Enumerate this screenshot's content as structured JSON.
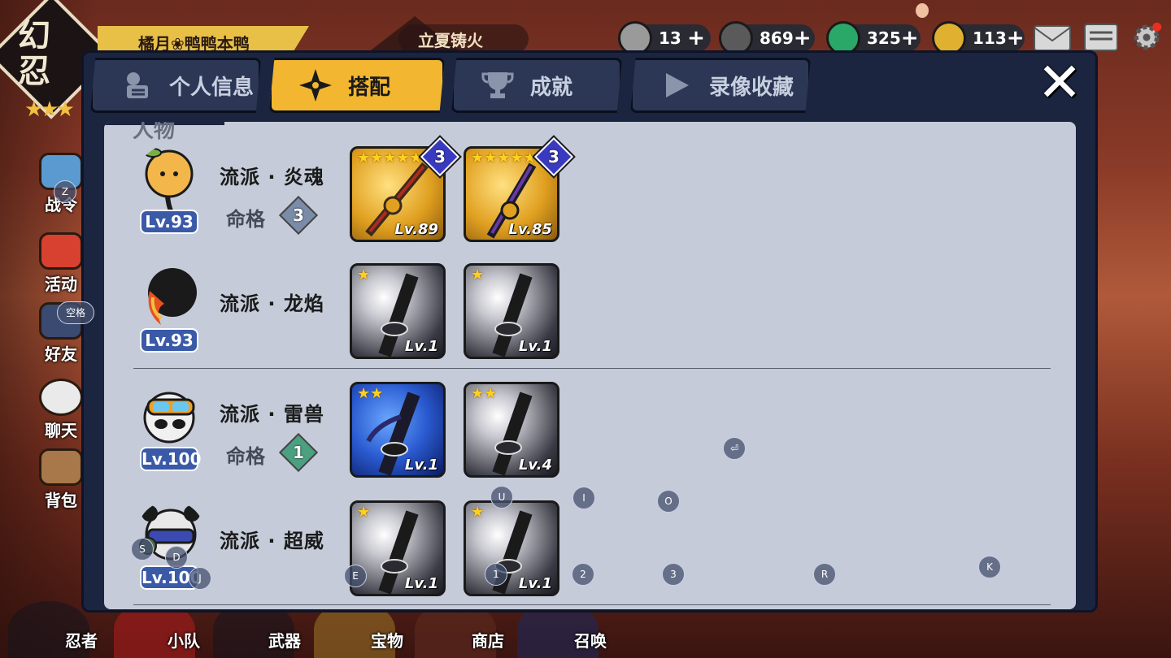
{
  "header": {
    "player_name": "橘月❀鸭鸭本鸭",
    "event_banner": "立夏铸火",
    "logo_text": "幻忍",
    "logo_stars": "★★★"
  },
  "currencies": [
    {
      "name": "scroll",
      "value": "13",
      "plus": "+",
      "color": "#9a9a9a"
    },
    {
      "name": "coin",
      "value": "869",
      "plus": "+",
      "color": "#5a5a5a"
    },
    {
      "name": "jade",
      "value": "325",
      "plus": "+",
      "color": "#2aa868"
    },
    {
      "name": "gold-key",
      "value": "113",
      "plus": "+",
      "color": "#e0b030"
    }
  ],
  "side_nav": [
    {
      "label": "战令"
    },
    {
      "label": "活动"
    },
    {
      "label": "好友"
    },
    {
      "label": "聊天"
    },
    {
      "label": "背包"
    }
  ],
  "bottom_nav": [
    {
      "label": "忍者"
    },
    {
      "label": "小队"
    },
    {
      "label": "武器"
    },
    {
      "label": "宝物"
    },
    {
      "label": "商店"
    },
    {
      "label": "召唤"
    }
  ],
  "tabs": [
    {
      "label": "个人信息",
      "active": false,
      "icon": "profile-icon"
    },
    {
      "label": "搭配",
      "active": true,
      "icon": "shuriken-icon"
    },
    {
      "label": "成就",
      "active": false,
      "icon": "trophy-icon"
    },
    {
      "label": "录像收藏",
      "active": false,
      "icon": "play-icon"
    }
  ],
  "close_label": "✕",
  "section_label": "人物",
  "characters": [
    {
      "level": "Lv.93",
      "school": "流派 · 炎魂",
      "destiny_label": "命格",
      "destiny_value": "3",
      "avatar_color": "#f2b64a",
      "weapons": [
        {
          "stars": 5,
          "rarity": "gold",
          "level": "Lv.89",
          "rank": "3"
        },
        {
          "stars": 5,
          "rarity": "gold",
          "level": "Lv.85",
          "rank": "3"
        }
      ]
    },
    {
      "level": "Lv.93",
      "school": "流派 · 龙焰",
      "destiny_label": "",
      "destiny_value": "",
      "avatar_color": "#1a1a1a",
      "weapons": [
        {
          "stars": 1,
          "rarity": "silver",
          "level": "Lv.1",
          "rank": ""
        },
        {
          "stars": 1,
          "rarity": "silver",
          "level": "Lv.1",
          "rank": ""
        }
      ]
    },
    {
      "level": "Lv.100",
      "school": "流派 · 雷兽",
      "destiny_label": "命格",
      "destiny_value": "1",
      "avatar_color": "#f0f0f0",
      "weapons": [
        {
          "stars": 2,
          "rarity": "blue",
          "level": "Lv.1",
          "rank": ""
        },
        {
          "stars": 2,
          "rarity": "silver",
          "level": "Lv.4",
          "rank": ""
        }
      ]
    },
    {
      "level": "Lv.100",
      "school": "流派 · 超威",
      "destiny_label": "",
      "destiny_value": "",
      "avatar_color": "#e8e8e8",
      "weapons": [
        {
          "stars": 1,
          "rarity": "silver",
          "level": "Lv.1",
          "rank": ""
        },
        {
          "stars": 1,
          "rarity": "silver",
          "level": "Lv.1",
          "rank": ""
        }
      ]
    }
  ],
  "key_hints": [
    {
      "key": "Z"
    },
    {
      "key": "空格"
    },
    {
      "key": "⏎"
    },
    {
      "key": "U"
    },
    {
      "key": "I"
    },
    {
      "key": "O"
    },
    {
      "key": "S"
    },
    {
      "key": "D"
    },
    {
      "key": "J"
    },
    {
      "key": "E"
    },
    {
      "key": "1"
    },
    {
      "key": "2"
    },
    {
      "key": "3"
    },
    {
      "key": "R"
    },
    {
      "key": "K"
    }
  ]
}
